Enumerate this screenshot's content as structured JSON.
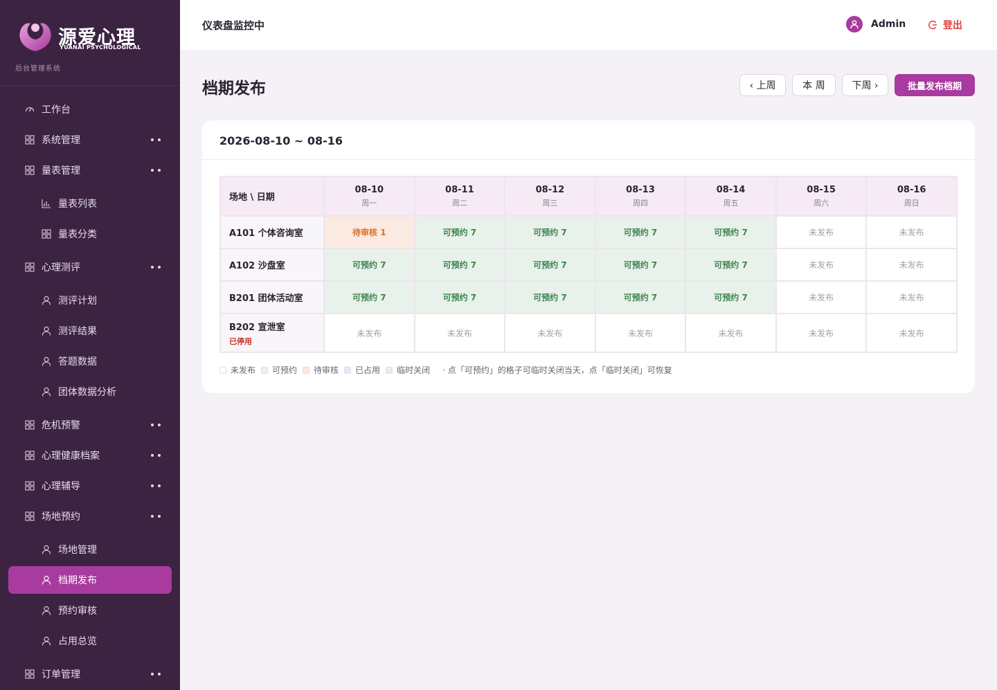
{
  "brand": {
    "name": "源爱心理",
    "en": "YUANAI PSYCHOLOGICAL",
    "subtitle": "后台管理系统"
  },
  "menu": [
    {
      "label": "工作台",
      "icon": "dashboard-icon",
      "level": 1
    },
    {
      "label": "系统管理",
      "icon": "grid-icon",
      "level": 1,
      "expandable": true
    },
    {
      "label": "量表管理",
      "icon": "grid-icon",
      "level": 1,
      "expandable": true
    },
    {
      "label": "量表列表",
      "icon": "bar-chart-icon",
      "level": 2
    },
    {
      "label": "量表分类",
      "icon": "grid-icon",
      "level": 2
    },
    {
      "label": "心理测评",
      "icon": "grid-icon",
      "level": 1,
      "expandable": true
    },
    {
      "label": "测评计划",
      "icon": "user-icon",
      "level": 2
    },
    {
      "label": "测评结果",
      "icon": "user-icon",
      "level": 2
    },
    {
      "label": "答题数据",
      "icon": "user-icon",
      "level": 2
    },
    {
      "label": "团体数据分析",
      "icon": "user-icon",
      "level": 2
    },
    {
      "label": "危机预警",
      "icon": "grid-icon",
      "level": 1,
      "expandable": true
    },
    {
      "label": "心理健康档案",
      "icon": "grid-icon",
      "level": 1,
      "expandable": true
    },
    {
      "label": "心理辅导",
      "icon": "grid-icon",
      "level": 1,
      "expandable": true
    },
    {
      "label": "场地预约",
      "icon": "grid-icon",
      "level": 1,
      "expandable": true
    },
    {
      "label": "场地管理",
      "icon": "user-icon",
      "level": 2
    },
    {
      "label": "档期发布",
      "icon": "user-icon",
      "level": 2,
      "active": true
    },
    {
      "label": "预约审核",
      "icon": "user-icon",
      "level": 2
    },
    {
      "label": "占用总览",
      "icon": "user-icon",
      "level": 2
    },
    {
      "label": "订单管理",
      "icon": "grid-icon",
      "level": 1,
      "expandable": true
    }
  ],
  "header": {
    "breadcrumb": "仪表盘监控中",
    "username": "Admin",
    "logout": "登出"
  },
  "page": {
    "title": "档期发布",
    "buttons": {
      "prev": "‹ 上周",
      "this": "本 周",
      "next": "下周 ›",
      "batch": "批量发布档期"
    }
  },
  "schedule": {
    "range": "2026-08-10 ~ 08-16",
    "corner": "场地 \\ 日期",
    "days": [
      {
        "date": "08-10",
        "weekday": "周一"
      },
      {
        "date": "08-11",
        "weekday": "周二"
      },
      {
        "date": "08-12",
        "weekday": "周三"
      },
      {
        "date": "08-13",
        "weekday": "周四"
      },
      {
        "date": "08-14",
        "weekday": "周五"
      },
      {
        "date": "08-15",
        "weekday": "周六"
      },
      {
        "date": "08-16",
        "weekday": "周日"
      }
    ],
    "rooms": [
      {
        "name": "A101 个体咨询室",
        "cells": [
          {
            "text": "待审核 1",
            "status": "pending"
          },
          {
            "text": "可预约 7",
            "status": "available"
          },
          {
            "text": "可预约 7",
            "status": "available"
          },
          {
            "text": "可预约 7",
            "status": "available"
          },
          {
            "text": "可预约 7",
            "status": "available"
          },
          {
            "text": "未发布",
            "status": "unpub"
          },
          {
            "text": "未发布",
            "status": "unpub"
          }
        ]
      },
      {
        "name": "A102 沙盘室",
        "cells": [
          {
            "text": "可预约 7",
            "status": "available"
          },
          {
            "text": "可预约 7",
            "status": "available"
          },
          {
            "text": "可预约 7",
            "status": "available"
          },
          {
            "text": "可预约 7",
            "status": "available"
          },
          {
            "text": "可预约 7",
            "status": "available"
          },
          {
            "text": "未发布",
            "status": "unpub"
          },
          {
            "text": "未发布",
            "status": "unpub"
          }
        ]
      },
      {
        "name": "B201 团体活动室",
        "cells": [
          {
            "text": "可预约 7",
            "status": "available"
          },
          {
            "text": "可预约 7",
            "status": "available"
          },
          {
            "text": "可预约 7",
            "status": "available"
          },
          {
            "text": "可预约 7",
            "status": "available"
          },
          {
            "text": "可预约 7",
            "status": "available"
          },
          {
            "text": "未发布",
            "status": "unpub"
          },
          {
            "text": "未发布",
            "status": "unpub"
          }
        ]
      },
      {
        "name": "B202 宣泄室",
        "tag": "已停用",
        "cells": [
          {
            "text": "未发布",
            "status": "unpub"
          },
          {
            "text": "未发布",
            "status": "unpub"
          },
          {
            "text": "未发布",
            "status": "unpub"
          },
          {
            "text": "未发布",
            "status": "unpub"
          },
          {
            "text": "未发布",
            "status": "unpub"
          },
          {
            "text": "未发布",
            "status": "unpub"
          },
          {
            "text": "未发布",
            "status": "unpub"
          }
        ]
      }
    ],
    "legend": [
      {
        "label": "未发布",
        "color": "#ffffff"
      },
      {
        "label": "可预约",
        "color": "#e8f1ea"
      },
      {
        "label": "待审核",
        "color": "#fbeae0"
      },
      {
        "label": "已占用",
        "color": "#e9e8f4"
      },
      {
        "label": "临时关闭",
        "color": "#eeeaef"
      }
    ],
    "hint": "· 点「可预约」的格子可临时关闭当天，点「临时关闭」可恢复"
  },
  "colors": {
    "sidebar": "#3c2342",
    "accent": "#a93a9f",
    "danger": "#e0413a"
  }
}
